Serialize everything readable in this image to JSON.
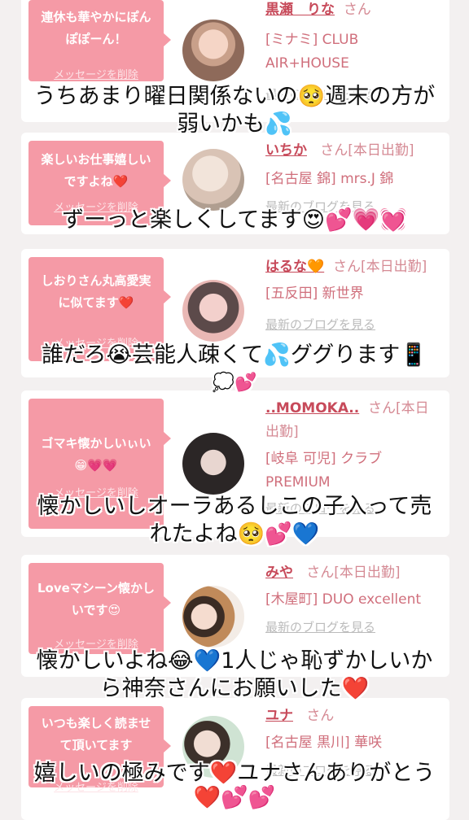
{
  "entries": [
    {
      "message": "連休も華やかにぽんぽぽーん！",
      "delete_label": "メッセージを削除",
      "name": "黒瀬　りな",
      "honorific": "さん",
      "shop": "[ミナミ] CLUB AIR+HOUSE",
      "blog_label": "最新のブログを見る",
      "caption_line1": "うちあまり曜日関係ないの🥺週末の方が",
      "caption_line2": "弱いかも💦"
    },
    {
      "message": "楽しいお仕事嬉しいですよね❤️",
      "delete_label": "メッセージを削除",
      "name": "いちか",
      "honorific": "さん[本日出勤]",
      "shop": "[名古屋 錦] mrs.J 錦",
      "blog_label": "最新のブログを見る",
      "caption_line1": "ずーっと楽しくしてます😍💕💗💓",
      "caption_line2": ""
    },
    {
      "message": "しおりさん丸高愛実に似てます❤️",
      "delete_label": "メッセージを削除",
      "name": "はるな🧡",
      "honorific": "さん[本日出勤]",
      "shop": "[五反田] 新世界",
      "blog_label": "最新のブログを見る",
      "caption_line1": "誰だろ😭芸能人疎くて💦ググります📱",
      "caption_line2": "💭💕"
    },
    {
      "message": "ゴマキ懐かしいぃい😁💗💗",
      "delete_label": "メッセージを削除",
      "name": "..MOMOKA..",
      "honorific": "さん[本日出勤]",
      "shop": "[岐阜 可児] クラブ PREMIUM",
      "blog_label": "最新のブログを見る",
      "caption_line1": "懐かしいしオーラあるしこの子入って売",
      "caption_line2": "れたよね🥺💕💙"
    },
    {
      "message": "Loveマシーン懐かしいです😍",
      "delete_label": "メッセージを削除",
      "name": "みや",
      "honorific": "さん[本日出勤]",
      "shop": "[木屋町] DUO excellent",
      "blog_label": "最新のブログを見る",
      "caption_line1": "懐かしいよね😂💙1人じゃ恥ずかしいか",
      "caption_line2": "ら神奈さんにお願いした❤️"
    },
    {
      "message": "いつも楽しく読ませて頂いてます",
      "delete_label": "メッセージを削除",
      "name": "ユナ",
      "honorific": "さん",
      "shop": "[名古屋 黒川] 華咲",
      "blog_label": "最新のブログを見る",
      "caption_line1": "嬉しいの極みです❤️ユナさんありがとう",
      "caption_line2": "❤️💕💕"
    }
  ],
  "colors": {
    "bubble": "#f59aa6",
    "name": "#c74a5a",
    "shop": "#d06f7c"
  }
}
